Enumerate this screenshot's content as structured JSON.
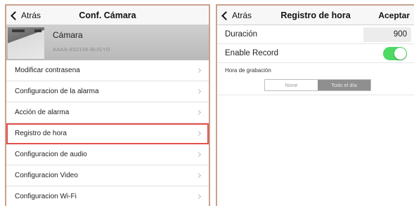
{
  "left": {
    "nav": {
      "back_label": "Atrás",
      "title": "Conf. Cámara"
    },
    "camera": {
      "name": "Cámara",
      "uid": "AAAA-932196-BUGYD"
    },
    "items": [
      {
        "label": "Modificar contrasena"
      },
      {
        "label": "Configuracion de la alarma"
      },
      {
        "label": "Acción de alarma"
      },
      {
        "label": "Registro de hora",
        "highlighted": true
      },
      {
        "label": "Configuracion de audio"
      },
      {
        "label": "Configuracion Video"
      },
      {
        "label": "Configuracion Wi-Fi"
      }
    ],
    "highlight_color": "#e3504b"
  },
  "right": {
    "nav": {
      "back_label": "Atrás",
      "title": "Registro de hora",
      "accept_label": "Aceptar"
    },
    "duration": {
      "label": "Duración",
      "value": "900"
    },
    "enable_record": {
      "label": "Enable Record",
      "on": true
    },
    "schedule": {
      "section_label": "Hora de grabación",
      "options": [
        "None",
        "Todo el día"
      ],
      "selected": "Todo el día"
    },
    "toggle_color": "#4cd964"
  }
}
